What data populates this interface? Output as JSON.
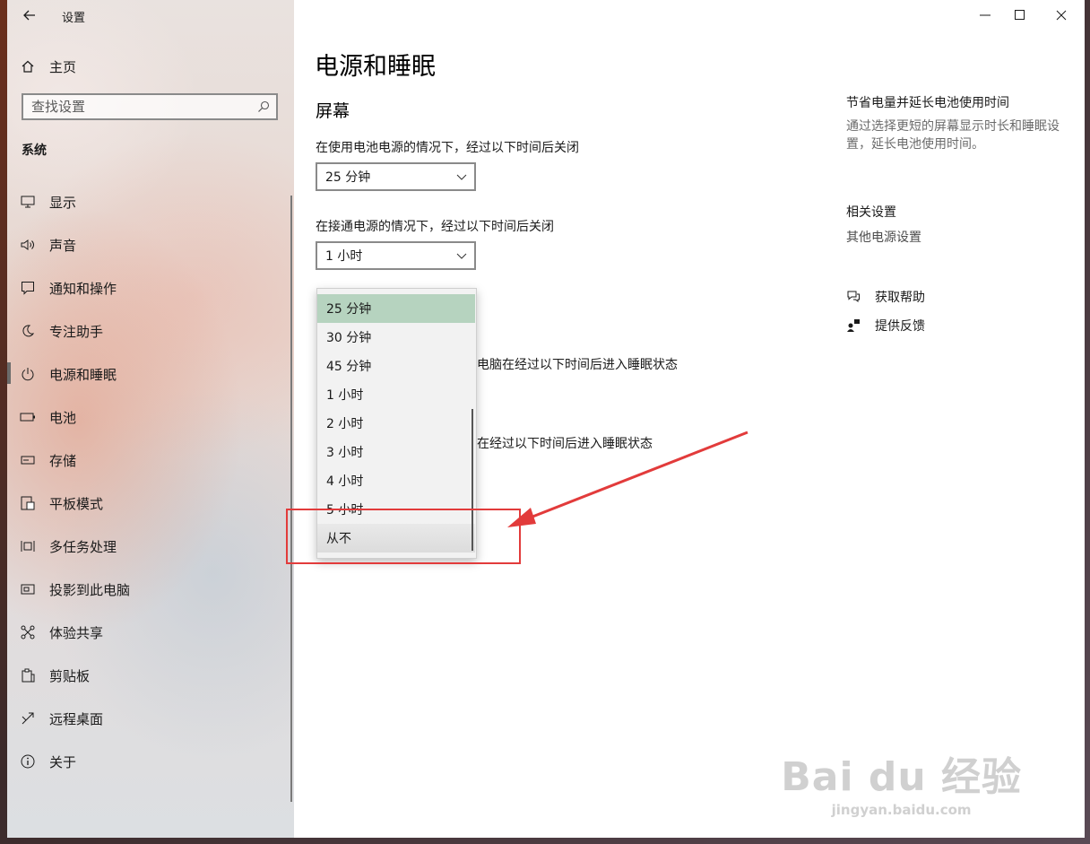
{
  "window": {
    "title": "设置"
  },
  "sidebar": {
    "home": "主页",
    "search_placeholder": "查找设置",
    "section": "系统",
    "items": [
      {
        "label": "显示",
        "icon": "monitor-icon"
      },
      {
        "label": "声音",
        "icon": "speaker-icon"
      },
      {
        "label": "通知和操作",
        "icon": "notification-icon"
      },
      {
        "label": "专注助手",
        "icon": "moon-icon"
      },
      {
        "label": "电源和睡眠",
        "icon": "power-icon",
        "active": true
      },
      {
        "label": "电池",
        "icon": "battery-icon"
      },
      {
        "label": "存储",
        "icon": "storage-icon"
      },
      {
        "label": "平板模式",
        "icon": "tablet-icon"
      },
      {
        "label": "多任务处理",
        "icon": "multitask-icon"
      },
      {
        "label": "投影到此电脑",
        "icon": "project-icon"
      },
      {
        "label": "体验共享",
        "icon": "share-icon"
      },
      {
        "label": "剪贴板",
        "icon": "clipboard-icon"
      },
      {
        "label": "远程桌面",
        "icon": "remote-desktop-icon"
      },
      {
        "label": "关于",
        "icon": "info-icon"
      }
    ]
  },
  "main": {
    "title": "电源和睡眠",
    "screen_heading": "屏幕",
    "battery_label": "在使用电池电源的情况下，经过以下时间后关闭",
    "battery_value": "25 分钟",
    "plugged_label": "在接通电源的情况下，经过以下时间后关闭",
    "plugged_value": "1 小时",
    "hidden_sleep_battery_tail": "电脑在经过以下时间后进入睡眠状态",
    "hidden_sleep_plugged_tail": "在经过以下时间后进入睡眠状态",
    "dropdown": {
      "options": [
        "25 分钟",
        "30 分钟",
        "45 分钟",
        "1 小时",
        "2 小时",
        "3 小时",
        "4 小时",
        "5 小时",
        "从不"
      ],
      "selected": "25 分钟",
      "hovered": "从不"
    }
  },
  "right_panel": {
    "save_heading": "节省电量并延长电池使用时间",
    "save_desc": "通过选择更短的屏幕显示时长和睡眠设置，延长电池使用时间。",
    "related_heading": "相关设置",
    "related_link": "其他电源设置",
    "help": "获取帮助",
    "feedback": "提供反馈"
  },
  "watermark": {
    "brand": "Bai du 经验",
    "url": "jingyan.baidu.com"
  },
  "colors": {
    "selected_option": "#b6d3bf",
    "annotation_red": "#e23b3b",
    "watermark": "#aaaaaa"
  }
}
